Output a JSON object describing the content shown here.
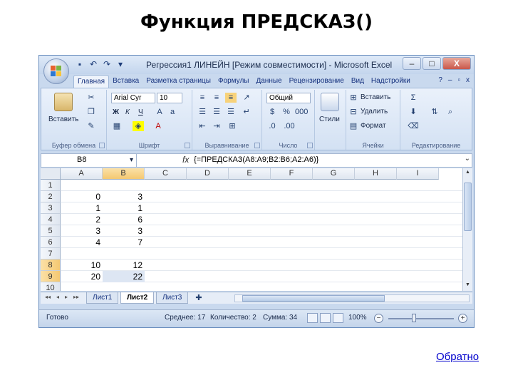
{
  "slide": {
    "title": "Функция ПРЕДСКАЗ()",
    "back_link": "Обратно"
  },
  "window": {
    "title": "Регрессия1 ЛИНЕЙН [Режим совместимости] - Microsoft Excel",
    "minimize": "–",
    "maximize": "□",
    "close": "X"
  },
  "ribbon_tabs": [
    "Главная",
    "Вставка",
    "Разметка страницы",
    "Формулы",
    "Данные",
    "Рецензирование",
    "Вид",
    "Надстройки"
  ],
  "ribbon_right": {
    "help": "?",
    "min": "–",
    "restore": "▫",
    "close": "x"
  },
  "ribbon": {
    "clipboard": {
      "paste": "Вставить",
      "label": "Буфер обмена"
    },
    "font": {
      "name": "Arial Cyr",
      "size": "10",
      "bold": "Ж",
      "italic": "К",
      "underline": "Ч",
      "label": "Шрифт"
    },
    "alignment": {
      "label": "Выравнивание"
    },
    "number": {
      "format": "Общий",
      "label": "Число"
    },
    "styles": {
      "styles_btn": "Стили",
      "label": ""
    },
    "cells": {
      "insert": "Вставить",
      "delete": "Удалить",
      "format": "Формат",
      "label": "Ячейки"
    },
    "editing": {
      "label": "Редактирование"
    }
  },
  "formula_bar": {
    "name_box": "B8",
    "fx": "fx",
    "formula": "{=ПРЕДСКАЗ(A8:A9;B2:B6;A2:A6)}"
  },
  "sheet": {
    "columns": [
      "A",
      "B",
      "C",
      "D",
      "E",
      "F",
      "G",
      "H",
      "I"
    ],
    "rows": [
      "1",
      "2",
      "3",
      "4",
      "5",
      "6",
      "7",
      "8",
      "9",
      "10"
    ],
    "cells": [
      [
        "",
        ""
      ],
      [
        "0",
        "3"
      ],
      [
        "1",
        "1"
      ],
      [
        "2",
        "6"
      ],
      [
        "3",
        "3"
      ],
      [
        "4",
        "7"
      ],
      [
        "",
        ""
      ],
      [
        "10",
        "12"
      ],
      [
        "20",
        "22"
      ],
      [
        "",
        ""
      ]
    ]
  },
  "sheet_tabs": [
    "Лист1",
    "Лист2",
    "Лист3"
  ],
  "active_sheet": "Лист2",
  "status": {
    "ready": "Готово",
    "average": "Среднее: 17",
    "count": "Количество: 2",
    "sum": "Сумма: 34",
    "zoom": "100%",
    "zoom_minus": "−",
    "zoom_plus": "+"
  },
  "colors": {
    "accent": "#15317e",
    "selected_header": "#f4c871",
    "window_frame": "#c9d9ee"
  }
}
